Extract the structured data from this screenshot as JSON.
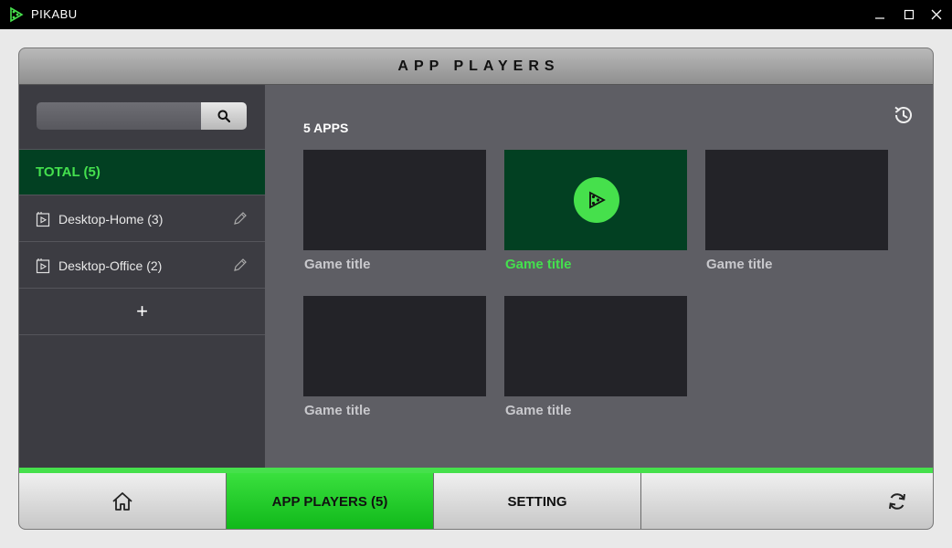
{
  "window": {
    "app_name": "PIKABU",
    "brand_color": "#46e04c"
  },
  "header": {
    "title": "APP PLAYERS"
  },
  "sidebar": {
    "search": {
      "value": "",
      "placeholder": ""
    },
    "total_label": "TOTAL (5)",
    "devices": [
      {
        "label": "Desktop-Home (3)",
        "icon": "device-screen-icon"
      },
      {
        "label": "Desktop-Office (2)",
        "icon": "device-screen-icon"
      }
    ],
    "add_label": "+"
  },
  "content": {
    "apps_count": "5 APPS",
    "games": [
      {
        "title": "Game title",
        "selected": false
      },
      {
        "title": "Game title",
        "selected": true
      },
      {
        "title": "Game title",
        "selected": false
      },
      {
        "title": "Game title",
        "selected": false
      },
      {
        "title": "Game title",
        "selected": false
      }
    ]
  },
  "bottom_nav": {
    "tabs": [
      {
        "label": "",
        "icon": "home-icon"
      },
      {
        "label": "APP PLAYERS (5)",
        "active": true
      },
      {
        "label": "SETTING"
      }
    ],
    "refresh_icon": "refresh-icon"
  }
}
